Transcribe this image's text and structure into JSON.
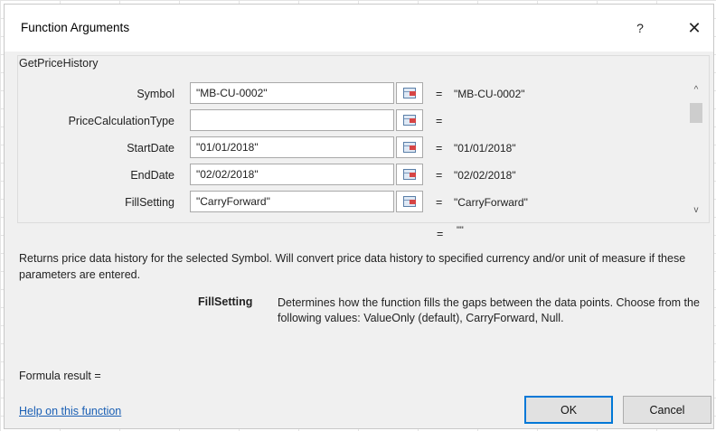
{
  "window": {
    "title": "Function Arguments",
    "help_glyph": "?",
    "close_glyph": "✕"
  },
  "function": {
    "name": "GetPriceHistory"
  },
  "arguments": [
    {
      "label": "Symbol",
      "value": "\"MB-CU-0002\"",
      "result": "\"MB-CU-0002\""
    },
    {
      "label": "PriceCalculationType",
      "value": "",
      "result": ""
    },
    {
      "label": "StartDate",
      "value": "\"01/01/2018\"",
      "result": "\"01/01/2018\""
    },
    {
      "label": "EndDate",
      "value": "\"02/02/2018\"",
      "result": "\"02/02/2018\""
    },
    {
      "label": "FillSetting",
      "value": "\"CarryForward\"",
      "result": "\"CarryForward\""
    }
  ],
  "equals_sign": "=",
  "formula_preview": "\"\"",
  "description": "Returns price data history for the selected Symbol. Will convert price data history to specified currency and/or unit of measure if these parameters are entered.",
  "parameter_help": {
    "name": "FillSetting",
    "text": "Determines how the function fills the gaps between the data points. Choose from the following values: ValueOnly (default), CarryForward, Null."
  },
  "formula_result_label": "Formula result =",
  "help_link": "Help on this function",
  "buttons": {
    "ok": "OK",
    "cancel": "Cancel"
  },
  "scrollbar": {
    "up_glyph": "^",
    "down_glyph": "v"
  }
}
